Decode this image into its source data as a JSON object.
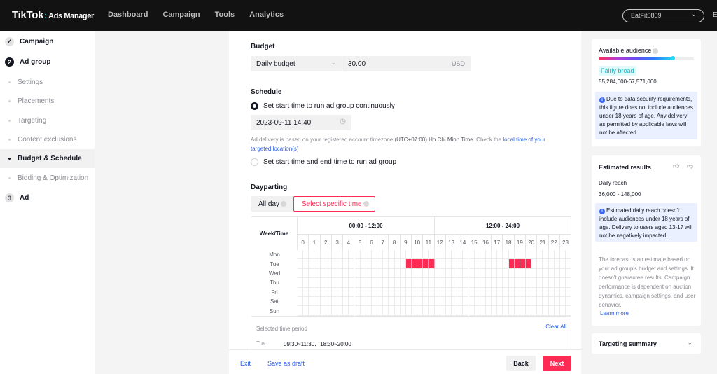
{
  "topbar": {
    "brand": "TikTok",
    "brand_suffix": "Ads Manager",
    "nav": [
      "Dashboard",
      "Campaign",
      "Tools",
      "Analytics"
    ],
    "account": "EatFit0809",
    "edge_text": "E"
  },
  "sidebar": {
    "campaign": "Campaign",
    "adgroup_num": "2",
    "adgroup": "Ad group",
    "sub_items": [
      "Settings",
      "Placements",
      "Targeting",
      "Content exclusions",
      "Budget & Schedule",
      "Bidding & Optimization"
    ],
    "active_sub": "Budget & Schedule",
    "ad_num": "3",
    "ad": "Ad"
  },
  "budget": {
    "label": "Budget",
    "type": "Daily budget",
    "amount": "30.00",
    "currency": "USD"
  },
  "schedule": {
    "label": "Schedule",
    "option1": "Set start time to run ad group continuously",
    "start_time": "2023-09-11 14:40",
    "hint_prefix": "Ad delivery is based on your registered account timezone ",
    "hint_tz": "(UTC+07:00) Ho Chi Minh Time",
    "hint_mid": ". Check the ",
    "hint_link": "local time of your targeted location(s)",
    "option2": "Set start time and end time to run ad group"
  },
  "dayparting": {
    "label": "Dayparting",
    "all_day": "All day",
    "specific": "Select specific time",
    "week_time": "Week/Time",
    "half1": "00:00 - 12:00",
    "half2": "12:00 - 24:00",
    "hours": [
      "0",
      "1",
      "2",
      "3",
      "4",
      "5",
      "6",
      "7",
      "8",
      "9",
      "10",
      "11",
      "12",
      "13",
      "14",
      "15",
      "16",
      "17",
      "18",
      "19",
      "20",
      "21",
      "22",
      "23"
    ],
    "days": [
      "Mon",
      "Tue",
      "Wed",
      "Thu",
      "Fri",
      "Sat",
      "Sun"
    ],
    "selected": {
      "Tue": [
        [
          19,
          23
        ],
        [
          37,
          40
        ]
      ]
    },
    "selected_label": "Selected time period",
    "clear_all": "Clear All",
    "summary_day": "Tue",
    "summary_times": "09:30~11:30、18:30~20:00"
  },
  "footer": {
    "exit": "Exit",
    "save_draft": "Save as draft",
    "back": "Back",
    "next": "Next"
  },
  "audience": {
    "title": "Available audience",
    "meter_fraction": 0.78,
    "level": "Fairly broad",
    "range": "55,284,000-67,571,000",
    "info": "Due to data security requirements, this figure does not include audiences under 18 years of age. Any delivery as permitted by applicable laws will not be affected."
  },
  "estimated": {
    "title": "Estimated results",
    "metric": "Daily reach",
    "range": "36,000 - 148,000",
    "info": "Estimated daily reach doesn't include audiences under 18 years of age. Delivery to users aged 13-17 will not be negatively impacted.",
    "note": "The forecast is an estimate based on your ad group's budget and settings. It doesn't guarantee results. Campaign performance is dependent on auction dynamics, campaign settings, and user behavior.",
    "learn_more": "Learn more"
  },
  "targeting_summary": {
    "title": "Targeting summary"
  },
  "colors": {
    "accent": "#fe2c55",
    "link": "#2b5de0",
    "teal": "#25f4ee"
  }
}
